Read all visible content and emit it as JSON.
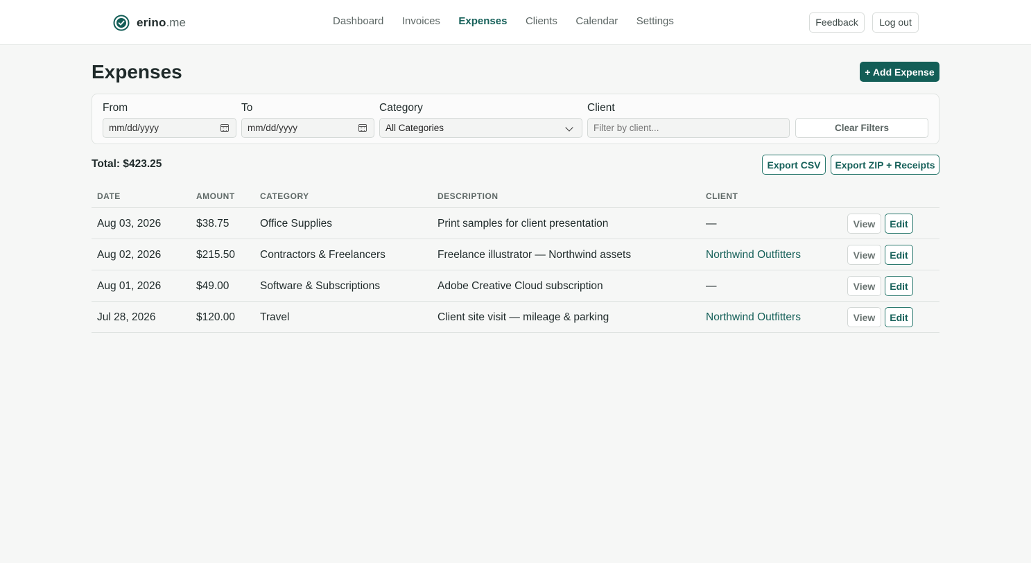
{
  "app": {
    "brand_name": "erino",
    "brand_tld": ".me"
  },
  "nav": {
    "items": [
      {
        "label": "Dashboard",
        "active": false
      },
      {
        "label": "Invoices",
        "active": false
      },
      {
        "label": "Expenses",
        "active": true
      },
      {
        "label": "Clients",
        "active": false
      },
      {
        "label": "Calendar",
        "active": false
      },
      {
        "label": "Settings",
        "active": false
      }
    ],
    "feedback_label": "Feedback",
    "logout_label": "Log out"
  },
  "header": {
    "title": "Expenses",
    "add_label": "+ Add Expense"
  },
  "filters": {
    "from_label": "From",
    "from_placeholder": "mm/dd/yyyy",
    "to_label": "To",
    "to_placeholder": "mm/dd/yyyy",
    "category_label": "Category",
    "category_selected": "All Categories",
    "client_label": "Client",
    "client_placeholder": "Filter by client...",
    "clear_label": "Clear Filters"
  },
  "summary": {
    "total": "Total: $423.25",
    "export_csv_label": "Export CSV",
    "export_zip_label": "Export ZIP + Receipts"
  },
  "table": {
    "headers": {
      "date": "DATE",
      "amount": "AMOUNT",
      "category": "CATEGORY",
      "description": "DESCRIPTION",
      "client": "CLIENT"
    },
    "rows": [
      {
        "date": "Aug 03, 2026",
        "amount": "$38.75",
        "category": "Office Supplies",
        "description": "Print samples for client presentation",
        "client": "—",
        "client_linked": false,
        "view": "View",
        "edit": "Edit"
      },
      {
        "date": "Aug 02, 2026",
        "amount": "$215.50",
        "category": "Contractors & Freelancers",
        "description": "Freelance illustrator — Northwind assets",
        "client": "Northwind Outfitters",
        "client_linked": true,
        "view": "View",
        "edit": "Edit"
      },
      {
        "date": "Aug 01, 2026",
        "amount": "$49.00",
        "category": "Software & Subscriptions",
        "description": "Adobe Creative Cloud subscription",
        "client": "—",
        "client_linked": false,
        "view": "View",
        "edit": "Edit"
      },
      {
        "date": "Jul 28, 2026",
        "amount": "$120.00",
        "category": "Travel",
        "description": "Client site visit — mileage & parking",
        "client": "Northwind Outfitters",
        "client_linked": true,
        "view": "View",
        "edit": "Edit"
      }
    ]
  },
  "colors": {
    "accent": "#135e57",
    "link": "#17615a",
    "background": "#f6f7f6"
  }
}
